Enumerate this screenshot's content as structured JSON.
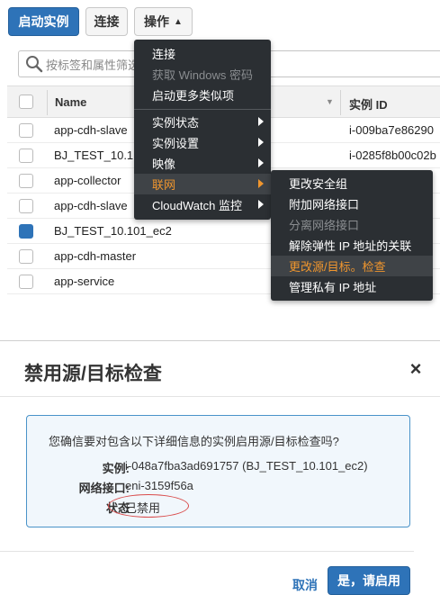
{
  "toolbar": {
    "launch_label": "启动实例",
    "connect_label": "连接",
    "actions_label": "操作"
  },
  "search": {
    "placeholder": "按标签和属性筛选"
  },
  "table": {
    "columns": [
      "Name",
      "实例 ID"
    ],
    "rows": [
      {
        "name": "app-cdh-slave",
        "id": "i-009ba7e86290",
        "selected": false
      },
      {
        "name": "BJ_TEST_10.1",
        "id": "i-0285f8b00c02b",
        "selected": false
      },
      {
        "name": "app-collector",
        "id": "",
        "selected": false
      },
      {
        "name": "app-cdh-slave",
        "id": "",
        "selected": false
      },
      {
        "name": "BJ_TEST_10.101_ec2",
        "id": "",
        "selected": true
      },
      {
        "name": "app-cdh-master",
        "id": "",
        "selected": false
      },
      {
        "name": "app-service",
        "id": "",
        "selected": false
      }
    ]
  },
  "actions_menu": {
    "items": [
      {
        "label": "连接",
        "disabled": false
      },
      {
        "label": "获取 Windows 密码",
        "disabled": true
      },
      {
        "label": "启动更多类似项",
        "disabled": false
      },
      {
        "label": "实例状态",
        "submenu": true
      },
      {
        "label": "实例设置",
        "submenu": true
      },
      {
        "label": "映像",
        "submenu": true
      },
      {
        "label": "联网",
        "submenu": true,
        "active": true
      },
      {
        "label": "CloudWatch 监控",
        "submenu": true
      }
    ]
  },
  "network_submenu": {
    "items": [
      {
        "label": "更改安全组",
        "disabled": false
      },
      {
        "label": "附加网络接口",
        "disabled": false
      },
      {
        "label": "分离网络接口",
        "disabled": true
      },
      {
        "label": "解除弹性 IP 地址的关联",
        "disabled": false
      },
      {
        "label": "更改源/目标。检查",
        "active": true
      },
      {
        "label": "管理私有 IP 地址",
        "disabled": false
      }
    ]
  },
  "dialog": {
    "title": "禁用源/目标检查",
    "close_symbol": "×",
    "question": "您确信要对包含以下详细信息的实例启用源/目标检查吗?",
    "instance_label": "实例:",
    "instance_value": "i-048a7fba3ad691757 (BJ_TEST_10.101_ec2)",
    "eni_label": "网络接口:",
    "eni_value": "eni-3159f56a",
    "status_label": "状态",
    "status_value": "已禁用",
    "cancel_label": "取消",
    "confirm_label": "是，请启用"
  },
  "colors": {
    "primary": "#2e73b8",
    "menu_bg": "#2b2f33",
    "menu_active_text": "#f0962e",
    "info_border": "#4a93c9",
    "highlight_ellipse": "#d94b4b"
  }
}
